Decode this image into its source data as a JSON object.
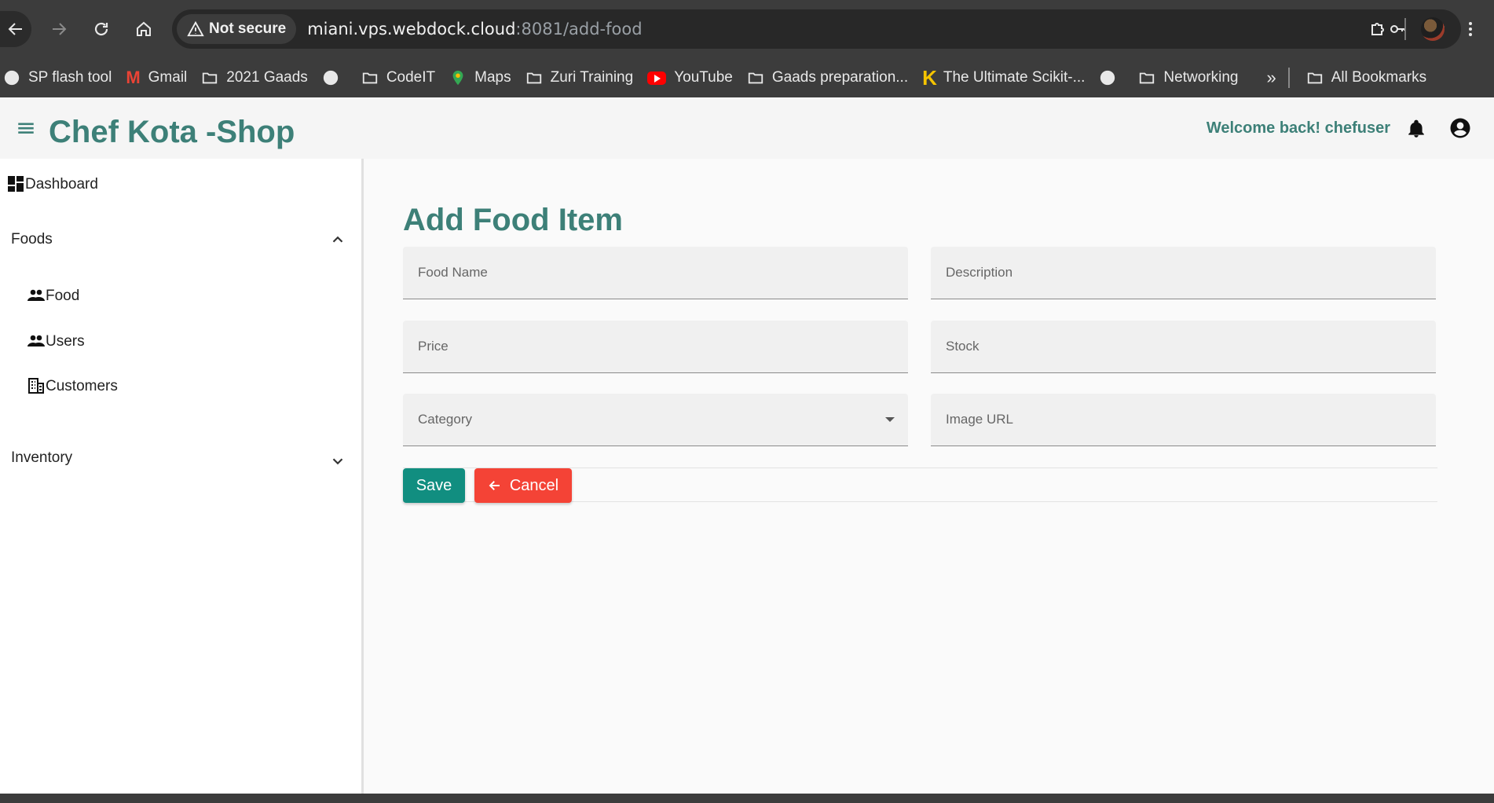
{
  "browser": {
    "security_chip": "Not secure",
    "url_host": "miani.vps.webdock.cloud",
    "url_path": ":8081/add-food",
    "bookmarks": [
      "SP flash tool",
      "Gmail",
      "2021 Gaads",
      "CodeIT",
      "Maps",
      "Zuri Training",
      "YouTube",
      "Gaads preparation...",
      "The Ultimate Scikit-...",
      "Networking"
    ],
    "overflow": "»",
    "all_bookmarks": "All Bookmarks"
  },
  "app": {
    "title": "Chef Kota -Shop",
    "welcome": "Welcome back! chefuser",
    "accent_color": "#3d8078"
  },
  "sidebar": {
    "dashboard": "Dashboard",
    "foods_group": "Foods",
    "items": [
      "Food",
      "Users",
      "Customers"
    ],
    "inventory_group": "Inventory"
  },
  "form": {
    "heading": "Add Food Item",
    "fields": {
      "food_name": "Food Name",
      "description": "Description",
      "price": "Price",
      "stock": "Stock",
      "category": "Category",
      "image_url": "Image URL"
    },
    "save": "Save",
    "cancel": "Cancel",
    "save_color": "#118e80",
    "cancel_color": "#f44336"
  }
}
